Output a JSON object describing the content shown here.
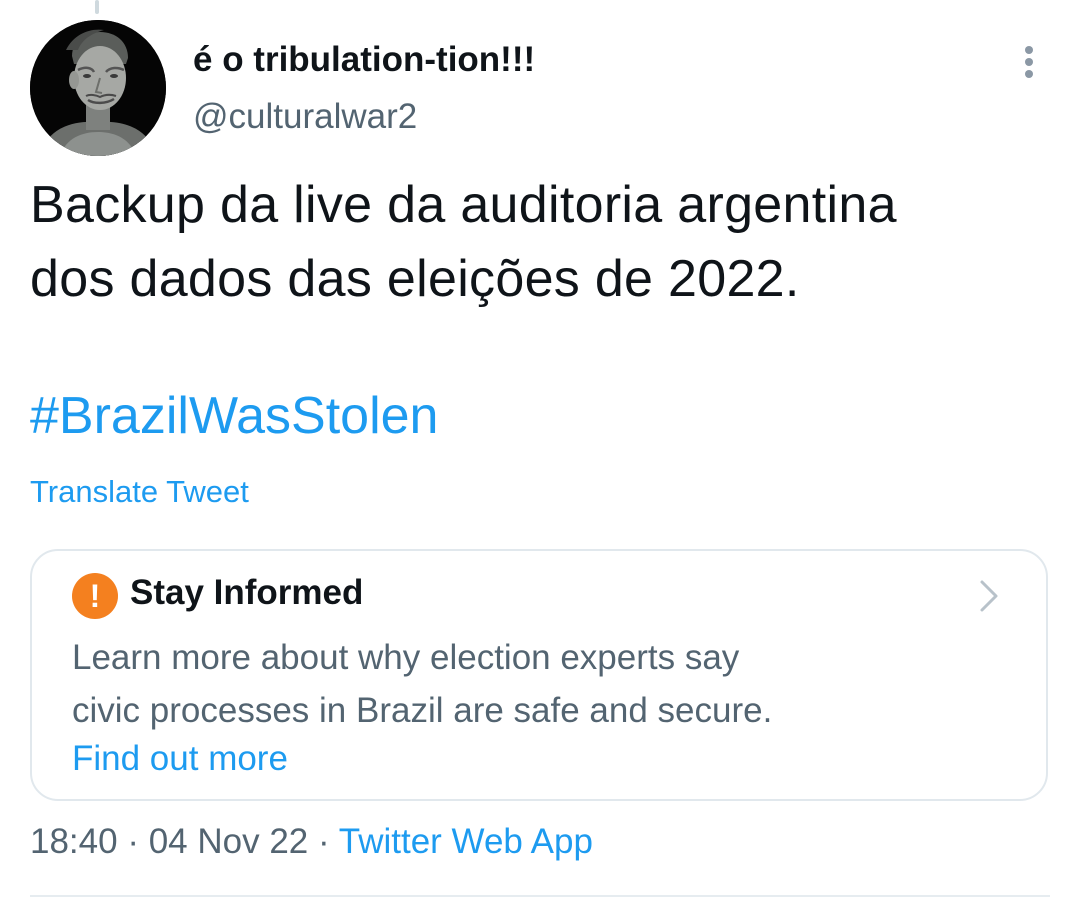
{
  "tweet": {
    "author": {
      "display_name": "é o tribulation-tion!!!",
      "handle": "@culturalwar2",
      "avatar_icon": "terracotta-warrior-avatar"
    },
    "menu_icon": "more-vertical-icon",
    "text_lines": [
      "Backup da live da auditoria argentina",
      "dos dados das eleições de 2022."
    ],
    "hashtag": "#BrazilWasStolen",
    "translate_label": "Translate Tweet",
    "notice": {
      "icon": "exclamation-circle-icon",
      "title": "Stay Informed",
      "body_lines": [
        "Learn more about why election experts say",
        "civic processes in Brazil are safe and secure."
      ],
      "link_label": "Find out more",
      "chevron_icon": "chevron-right-icon"
    },
    "meta": {
      "time": "18:40",
      "separator": "·",
      "date": "04 Nov 22",
      "source": "Twitter Web App"
    }
  },
  "colors": {
    "link": "#1d9bf0",
    "secondary_text": "#536471",
    "primary_text": "#0f1419",
    "warning": "#f4801f",
    "border": "#e1e8ed"
  }
}
